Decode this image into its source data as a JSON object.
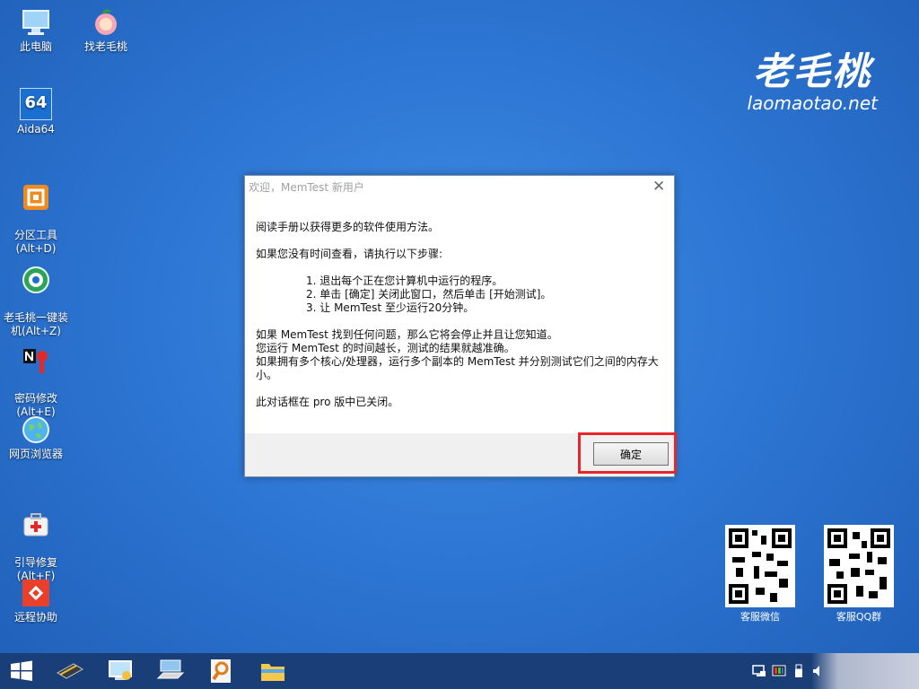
{
  "desktop": {
    "icons": [
      {
        "label": "此电脑",
        "icon": "computer-icon"
      },
      {
        "label": "找老毛桃",
        "icon": "peach-icon"
      },
      {
        "label": "Aida64",
        "icon": "aida64-icon",
        "glyph": "64"
      },
      {
        "label": "分区工具\n(Alt+D)",
        "icon": "partition-tool-icon"
      },
      {
        "label": "老毛桃一键装\n机(Alt+Z)",
        "icon": "one-click-install-icon"
      },
      {
        "label": "密码修改\n(Alt+E)",
        "icon": "password-key-icon"
      },
      {
        "label": "网页浏览器",
        "icon": "globe-icon"
      },
      {
        "label": "引导修复\n(Alt+F)",
        "icon": "first-aid-kit-icon"
      },
      {
        "label": "远程协助",
        "icon": "remote-assist-icon"
      }
    ],
    "brand": {
      "name": "老毛桃",
      "url": "laomaotao.net"
    },
    "qr": [
      {
        "caption": "客服微信",
        "icon": "qr-code-icon"
      },
      {
        "caption": "客服QQ群",
        "icon": "qr-code-icon"
      }
    ]
  },
  "dialog": {
    "title": "欢迎，MemTest 新用户",
    "close_glyph": "✕",
    "intro": "阅读手册以获得更多的软件使用方法。",
    "steps_intro": "如果您没有时间查看，请执行以下步骤:",
    "steps": [
      "1. 退出每个正在您计算机中运行的程序。",
      "2. 单击 [确定] 关闭此窗口，然后单击 [开始测试]。",
      "3. 让 MemTest 至少运行20分钟。"
    ],
    "notes": [
      "如果 MemTest 找到任何问题，那么它将会停止并且让您知道。",
      "您运行 MemTest 的时间越长，测试的结果就越准确。",
      "如果拥有多个核心/处理器，运行多个副本的 MemTest 并分别测试它们之间的内存大小。"
    ],
    "footer_note": "此对话框在 pro 版中已关闭。",
    "ok_label": "确定",
    "highlight_color": "#e5262b"
  },
  "taskbar": {
    "buttons": [
      {
        "name": "start-button",
        "icon": "windows-logo-icon"
      },
      {
        "name": "memory-chip-button",
        "icon": "ram-chip-icon"
      },
      {
        "name": "control-panel-button",
        "icon": "control-panel-icon"
      },
      {
        "name": "keyboard-button",
        "icon": "keyboard-icon"
      },
      {
        "name": "search-tool-button",
        "icon": "magnifier-icon"
      },
      {
        "name": "file-explorer-button",
        "icon": "folder-icon"
      }
    ],
    "tray": [
      "network-icon",
      "color-display-icon",
      "usb-icon",
      "speaker-icon"
    ],
    "color": "#1a3f78"
  }
}
